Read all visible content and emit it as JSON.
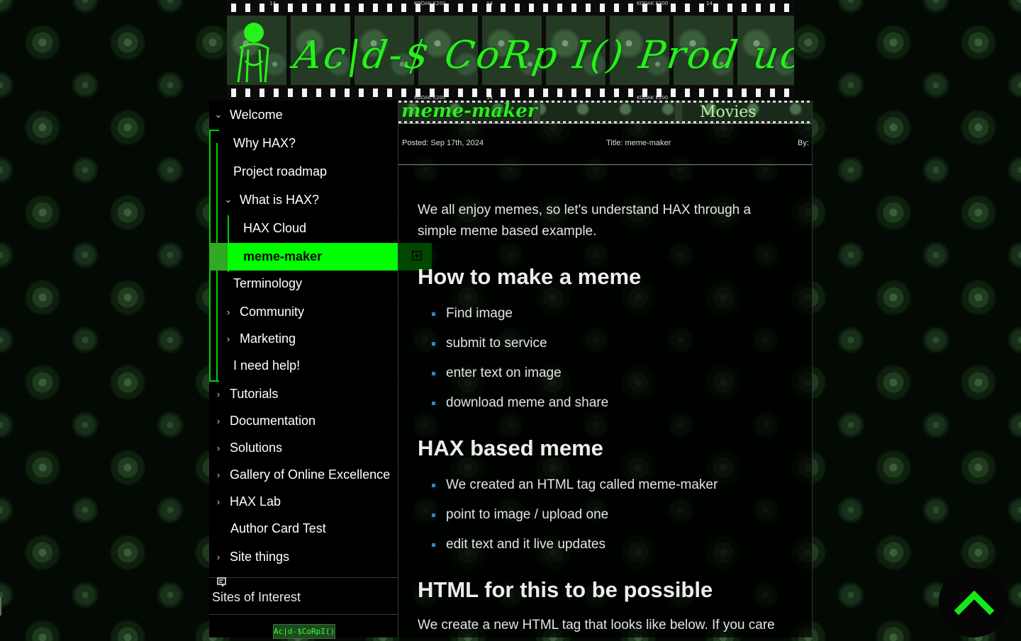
{
  "banner": {
    "title": "Ac|d-$ CoRp I() Prod uctio nz",
    "film_marks": [
      "14",
      "KODAK E200",
      "14",
      "KODAK E200",
      "14",
      "KODAK E200",
      "14",
      "KODAK E200"
    ]
  },
  "nav": {
    "items": [
      {
        "label": "Welcome",
        "chevron": "expanded"
      },
      {
        "label": "Why HAX?"
      },
      {
        "label": "Project roadmap"
      },
      {
        "label": "What is HAX?",
        "chevron": "expanded"
      },
      {
        "label": "HAX Cloud"
      },
      {
        "label": "meme-maker",
        "active": true
      },
      {
        "label": "Terminology"
      },
      {
        "label": "Community",
        "chevron": "collapsed"
      },
      {
        "label": "Marketing",
        "chevron": "collapsed"
      },
      {
        "label": "I need help!"
      },
      {
        "label": "Tutorials",
        "chevron": "collapsed"
      },
      {
        "label": "Documentation",
        "chevron": "collapsed"
      },
      {
        "label": "Solutions",
        "chevron": "collapsed"
      },
      {
        "label": "Gallery of Online Excellence",
        "chevron": "collapsed"
      },
      {
        "label": "HAX Lab",
        "chevron": "collapsed"
      },
      {
        "label": "Author Card Test"
      },
      {
        "label": "Site things",
        "chevron": "collapsed"
      }
    ],
    "sites_of_interest": "Sites of Interest",
    "badge": "Ac|d-$CoRpI()",
    "accent_color": "#00ff00"
  },
  "article": {
    "strip_title": "meme-maker",
    "strip_movies": "Movies",
    "posted": "Posted: Sep 17th, 2024",
    "title_meta": "Title: meme-maker",
    "by": "By:",
    "intro": "We all enjoy memes, so let's understand HAX through a simple meme based example.",
    "section1": {
      "heading": "How to make a meme",
      "bullets": [
        "Find image",
        "submit to service",
        "enter text on image",
        "download meme and share"
      ]
    },
    "section2": {
      "heading": "HAX based meme",
      "bullets": [
        "We created an HTML tag called meme-maker",
        "point to image / upload one",
        "edit text and it live updates"
      ]
    },
    "section3": {
      "heading": "HTML for this to be possible",
      "text": "We create a new HTML tag that looks like below. If you care"
    }
  },
  "icons": {
    "chevron_expanded": "⌄",
    "chevron_collapsed": "›",
    "scroll_top": "chevron-up-icon",
    "add_item": "plus-square-icon"
  }
}
